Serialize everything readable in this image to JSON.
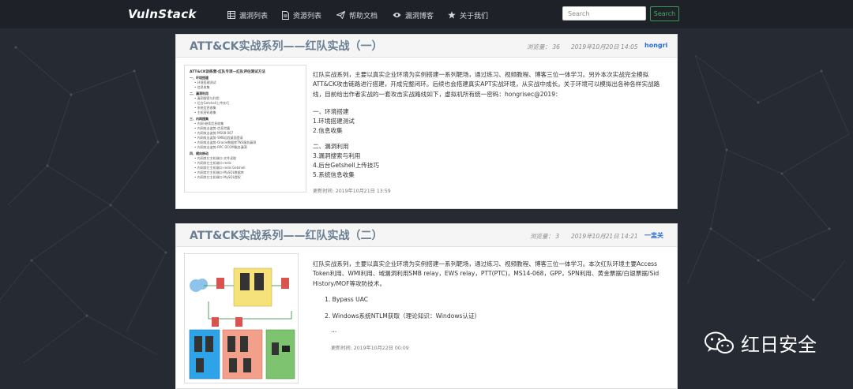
{
  "brand": "VulnStack",
  "nav": {
    "items": [
      {
        "label": "漏洞列表",
        "icon": "table-icon"
      },
      {
        "label": "资源列表",
        "icon": "file-icon"
      },
      {
        "label": "帮助文档",
        "icon": "paper-plane-icon"
      },
      {
        "label": "漏洞博客",
        "icon": "eye-icon"
      },
      {
        "label": "关于我们",
        "icon": "star-icon"
      }
    ]
  },
  "search": {
    "placeholder": "Search",
    "button": "Search"
  },
  "posts": [
    {
      "title": "ATT&CK实战系列——红队实战（一）",
      "views": "浏览量：   36",
      "date": "2019年10月20日 14:05",
      "author": "hongri",
      "desc": "红队实战系列，主要以真实企业环境为实例搭建一系列靶场，通过练习、视频教程、博客三位一体学习。另外本次实战完全模拟ATT&CK攻击链路进行搭建，开成完整闭环。后续也会搭建真实APT实战环境，从实战中成长。关于环境可以模拟出各种各样实战路线，目前给出作者实战的一套攻击实战路线如下，虚拟机所有统一密码：hongrisec@2019：",
      "list": [
        "一、环境搭建",
        "1.环境搭建测试",
        "2.信息收集",
        "二、漏洞利用",
        "3.漏洞搜索与利用",
        "4.后台Getshell上传技巧",
        "5.系统信息收集"
      ],
      "updated": "更新时间: 2019年10月21日 13:59",
      "thumb": {
        "title": "ATT&CK训练营-红队专项—红队评估测试方法",
        "lines": [
          {
            "t": "一、环境搭建",
            "h": true
          },
          {
            "t": "• 环境搭建测试",
            "h": false
          },
          {
            "t": "• 信息收集",
            "h": false
          },
          {
            "t": "二、漏洞利用",
            "h": true
          },
          {
            "t": "• 漏洞搜索与利用",
            "h": false
          },
          {
            "t": "• 后台Getshell上传技巧",
            "h": false
          },
          {
            "t": "• 系统信息收集",
            "h": false
          },
          {
            "t": "• 主机密码收集",
            "h": false
          },
          {
            "t": "三、内网搜集",
            "h": true
          },
          {
            "t": "• 内网-继续信息收集",
            "h": false
          },
          {
            "t": "• 内网攻击姿势-信息泄露",
            "h": false
          },
          {
            "t": "• 内网攻击姿势-MS08-067",
            "h": false
          },
          {
            "t": "• 内网攻击姿势-SMB远程桌面登录",
            "h": false
          },
          {
            "t": "• 内网攻击姿势-Oracle数据库TNS服务漏洞",
            "h": false
          },
          {
            "t": "• 内网攻击姿势-RPC DCOM服务漏洞",
            "h": false
          },
          {
            "t": "四、横向移动",
            "h": true
          },
          {
            "t": "• 内网其它主机端口-文件读取",
            "h": false
          },
          {
            "t": "• 内网其它主机端口-redis",
            "h": false
          },
          {
            "t": "• 内网其它主机端口-redis Getshell",
            "h": false
          },
          {
            "t": "• 内网其它主机端口-MySQL数据库",
            "h": false
          },
          {
            "t": "• 内网其它主机端口-MySQL提权",
            "h": false
          }
        ]
      }
    },
    {
      "title": "ATT&CK实战系列——红队实战（二）",
      "views": "浏览量：  3",
      "date": "2019年10月21日 14:21",
      "author": "一盅关",
      "desc": "红队实战系列，主要以真实企业环境为实例搭建一系列靶场，通过练习、视频教程、博客三位一体学习。本次红队环境主要Access Token利用、WMI利用、域漏洞利用SMB relay，EWS relay，PTT(PTC)，MS14-068，GPP，SPN利用、黄金票据/白银票据/Sid History/MOF等攻防技术。",
      "list": [
        "1. Bypass UAC",
        "2. Windows系统NTLM获取（理论知识：Windows认证）",
        "..."
      ],
      "updated": "更新时间: 2019年10月22日 00:09"
    }
  ],
  "watermark": "红日安全",
  "colors": {
    "accent_green": "#4cae62",
    "author_blue": "#2a6bd8",
    "title_gray": "#6a7f94"
  }
}
